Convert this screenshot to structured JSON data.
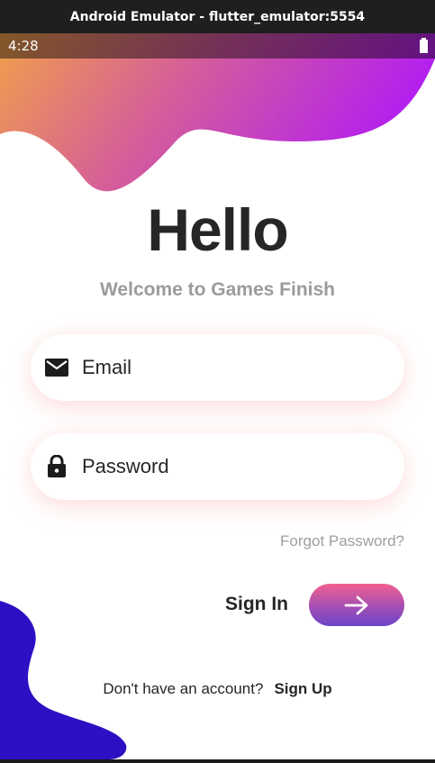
{
  "window": {
    "title": "Android Emulator - flutter_emulator:5554"
  },
  "status_bar": {
    "time": "4:28",
    "battery_icon": "battery-full-icon"
  },
  "header": {
    "title": "Hello",
    "subtitle": "Welcome to Games Finish"
  },
  "form": {
    "email": {
      "placeholder": "Email",
      "value": "",
      "icon": "mail-icon"
    },
    "password": {
      "placeholder": "Password",
      "value": "",
      "icon": "lock-icon"
    },
    "forgot_label": "Forgot Password?"
  },
  "actions": {
    "sign_in_label": "Sign In",
    "sign_in_icon": "arrow-right-icon"
  },
  "footer": {
    "prompt": "Don't have an account?",
    "signup_label": "Sign Up"
  },
  "colors": {
    "top_wave_start": "#f0a04b",
    "top_wave_mid": "#d65f98",
    "top_wave_end": "#b31ef0",
    "bottom_wave": "#2d0fc4",
    "button_top": "#f2608f",
    "button_bottom": "#6a44c8",
    "title_text": "#262626",
    "muted_text": "#9b9b9b"
  }
}
